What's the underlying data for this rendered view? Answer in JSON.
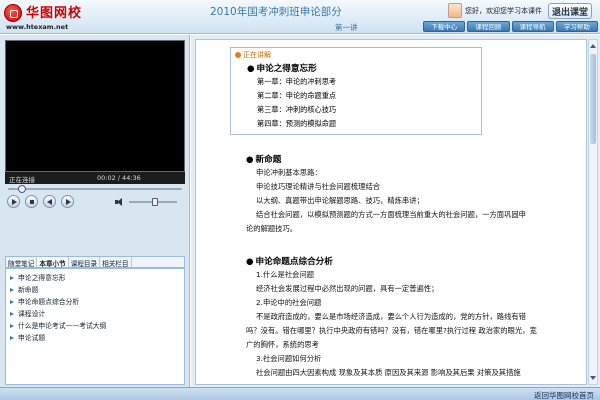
{
  "header": {
    "logo_name": "华图网校",
    "logo_url": "www.htexam.net",
    "title": "2010年国考冲刺班申论部分",
    "lecture": "第一讲",
    "welcome": "您好，欢迎您学习本课件",
    "exit_label": "退出课堂",
    "buttons": [
      "下载中心",
      "课程回顾",
      "课程导航",
      "学习帮助"
    ]
  },
  "player": {
    "status": "正在连接",
    "time": "00:02 / 44:36",
    "progress": 0.06,
    "volume": 0.55
  },
  "sidebar": {
    "tabs": [
      "随堂笔记",
      "本章小节",
      "课程目录",
      "相关栏目"
    ],
    "active_tab": 1,
    "items": [
      "申论之得意忘形",
      "新命题",
      "申论命题点综合分析",
      "课程设计",
      "什么是申论考试——考试大纲",
      "申论试题"
    ]
  },
  "content": {
    "now_label": "正在讲解",
    "section1": {
      "title": "申论之得意忘形",
      "chapters": [
        "第一章：申论的冲刺思考",
        "第二章：申论的命题重点",
        "第三章：冲刺的核心技巧",
        "第四章：预测的模拟命题"
      ]
    },
    "section2": {
      "title": "新命题",
      "lines": [
        "申论冲刺基本思路：",
        "申论技巧理论精讲与社会问题梳理结合",
        "以大纲、真题带出申论解题思路、技巧，精炼串讲；",
        "结合社会问题，以模拟预测题的方式一方面梳理当前重大的社会问题，一方面巩固申",
        "论的解题技巧。"
      ]
    },
    "section3": {
      "title": "申论命题点综合分析",
      "lines": [
        "1.什么是社会问题",
        "经济社会发展过程中必然出现的问题，具有一定普遍性；",
        "2.申论中的社会问题",
        "不是政府造成的，要么是市场经济造成，要么个人行为造成的，党的方针，路线有错",
        "吗？没有。错在哪里？执行中央政府有错吗？没有，错在哪里?执行过程 政治家的眼光，宽",
        "广的胸怀，系统的思考",
        "3.社会问题如何分析",
        "社会问题由四大因素构成 现象及其本质 原因及其来源 影响及其后果 对策及其措施"
      ]
    }
  },
  "footer": {
    "back_link": "返回华图网校首页"
  }
}
